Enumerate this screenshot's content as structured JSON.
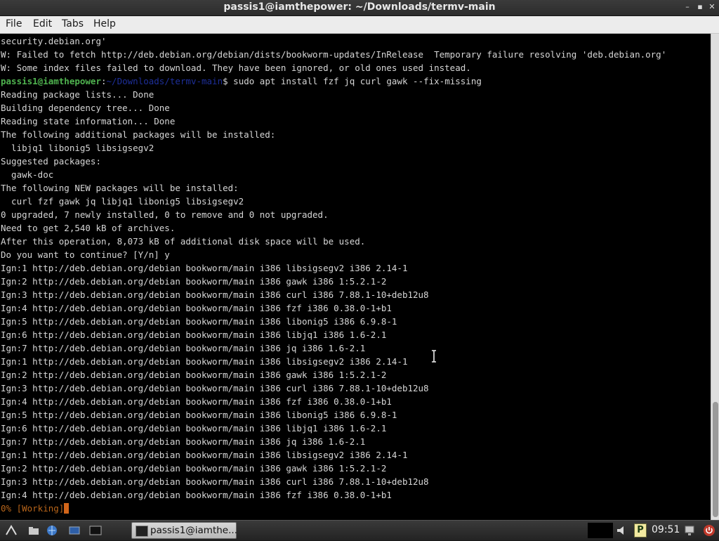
{
  "window": {
    "title": "passis1@iamthepower: ~/Downloads/termv-main",
    "controls": {
      "minimize": "–",
      "maximize": "▪",
      "close": "✕"
    }
  },
  "menu": {
    "file": "File",
    "edit": "Edit",
    "tabs": "Tabs",
    "help": "Help"
  },
  "terminal": {
    "lines": [
      "security.debian.org'",
      "W: Failed to fetch http://deb.debian.org/debian/dists/bookworm-updates/InRelease  Temporary failure resolving 'deb.debian.org'",
      "W: Some index files failed to download. They have been ignored, or old ones used instead.",
      "",
      "Reading package lists... Done",
      "Building dependency tree... Done",
      "Reading state information... Done",
      "The following additional packages will be installed:",
      "  libjq1 libonig5 libsigsegv2",
      "Suggested packages:",
      "  gawk-doc",
      "The following NEW packages will be installed:",
      "  curl fzf gawk jq libjq1 libonig5 libsigsegv2",
      "0 upgraded, 7 newly installed, 0 to remove and 0 not upgraded.",
      "Need to get 2,540 kB of archives.",
      "After this operation, 8,073 kB of additional disk space will be used.",
      "Do you want to continue? [Y/n] y",
      "Ign:1 http://deb.debian.org/debian bookworm/main i386 libsigsegv2 i386 2.14-1",
      "Ign:2 http://deb.debian.org/debian bookworm/main i386 gawk i386 1:5.2.1-2",
      "Ign:3 http://deb.debian.org/debian bookworm/main i386 curl i386 7.88.1-10+deb12u8",
      "Ign:4 http://deb.debian.org/debian bookworm/main i386 fzf i386 0.38.0-1+b1",
      "Ign:5 http://deb.debian.org/debian bookworm/main i386 libonig5 i386 6.9.8-1",
      "Ign:6 http://deb.debian.org/debian bookworm/main i386 libjq1 i386 1.6-2.1",
      "Ign:7 http://deb.debian.org/debian bookworm/main i386 jq i386 1.6-2.1",
      "Ign:1 http://deb.debian.org/debian bookworm/main i386 libsigsegv2 i386 2.14-1",
      "Ign:2 http://deb.debian.org/debian bookworm/main i386 gawk i386 1:5.2.1-2",
      "Ign:3 http://deb.debian.org/debian bookworm/main i386 curl i386 7.88.1-10+deb12u8",
      "Ign:4 http://deb.debian.org/debian bookworm/main i386 fzf i386 0.38.0-1+b1",
      "Ign:5 http://deb.debian.org/debian bookworm/main i386 libonig5 i386 6.9.8-1",
      "Ign:6 http://deb.debian.org/debian bookworm/main i386 libjq1 i386 1.6-2.1",
      "Ign:7 http://deb.debian.org/debian bookworm/main i386 jq i386 1.6-2.1",
      "Ign:1 http://deb.debian.org/debian bookworm/main i386 libsigsegv2 i386 2.14-1",
      "Ign:2 http://deb.debian.org/debian bookworm/main i386 gawk i386 1:5.2.1-2",
      "Ign:3 http://deb.debian.org/debian bookworm/main i386 curl i386 7.88.1-10+deb12u8",
      "Ign:4 http://deb.debian.org/debian bookworm/main i386 fzf i386 0.38.0-1+b1"
    ],
    "prompt": {
      "user_host": "passis1@iamthepower",
      "separator": ":",
      "path": "~/Downloads/termv-main",
      "dollar": "$",
      "command": " sudo apt install fzf jq curl gawk --fix-missing"
    },
    "status_line": "0% [Working]"
  },
  "taskbar": {
    "task_label": "passis1@iamthe...",
    "clock": "09:51",
    "tray_p_label": "P",
    "icons": [
      "start-menu-icon",
      "file-manager-icon",
      "browser-icon",
      "show-desktop-icon",
      "terminal-icon",
      "volume-icon",
      "network-icon",
      "power-icon"
    ]
  },
  "colors": {
    "prompt_user": "#4fb34f",
    "prompt_path": "#1e2f9a",
    "working_text": "#b8651a",
    "cursor": "#d2651a"
  }
}
